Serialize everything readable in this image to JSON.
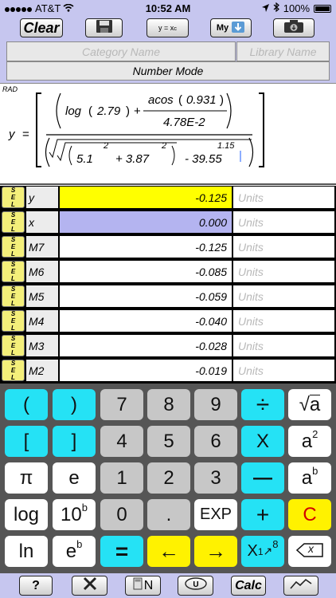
{
  "status": {
    "carrier": "AT&T",
    "time": "10:52 AM",
    "battery": "100%",
    "battery_level": 1.0
  },
  "toolbar": {
    "clear": "Clear",
    "yx": "y = x",
    "yx_sub": "c",
    "my": "My"
  },
  "header": {
    "category_placeholder": "Category Name",
    "library_placeholder": "Library Name",
    "mode": "Number Mode"
  },
  "equation": {
    "angle_mode": "RAD",
    "lhs": "y",
    "eq": "=",
    "log": "log",
    "log_arg": "2.79",
    "plus": "+",
    "acos": "acos",
    "acos_arg": "0.931",
    "divisor": "4.78E-2",
    "base1": "5.1",
    "exp1": "2",
    "plus2": "+ 3.87",
    "exp2": "2",
    "minus": "- 39.55",
    "exp3": "1.15",
    "lp": "(",
    "rp": ")"
  },
  "variables": [
    {
      "name": "y",
      "value": "-0.125",
      "units": "Units",
      "color": "#ffff00"
    },
    {
      "name": "x",
      "value": "0.000",
      "units": "Units",
      "color": "#b4b4f0"
    },
    {
      "name": "M7",
      "value": "-0.125",
      "units": "Units",
      "color": "#ffffff"
    },
    {
      "name": "M6",
      "value": "-0.085",
      "units": "Units",
      "color": "#ffffff"
    },
    {
      "name": "M5",
      "value": "-0.059",
      "units": "Units",
      "color": "#ffffff"
    },
    {
      "name": "M4",
      "value": "-0.040",
      "units": "Units",
      "color": "#ffffff"
    },
    {
      "name": "M3",
      "value": "-0.028",
      "units": "Units",
      "color": "#ffffff"
    },
    {
      "name": "M2",
      "value": "-0.019",
      "units": "Units",
      "color": "#ffffff"
    }
  ],
  "sel_label": "SEL",
  "keys": {
    "lparen": "(",
    "rparen": ")",
    "seven": "7",
    "eight": "8",
    "nine": "9",
    "divide": "÷",
    "sqrt": "a",
    "lbracket": "[",
    "rbracket": "]",
    "four": "4",
    "five": "5",
    "six": "6",
    "multiply": "X",
    "square": "a",
    "square_exp": "2",
    "pi": "π",
    "e": "e",
    "one": "1",
    "two": "2",
    "three": "3",
    "minus": "—",
    "power": "a",
    "power_exp": "b",
    "log": "log",
    "tenpow": "10",
    "tenpow_exp": "b",
    "zero": "0",
    "dot": ".",
    "exp": "EXP",
    "plus": "+",
    "clear": "C",
    "ln": "ln",
    "epow": "e",
    "epow_exp": "b",
    "equals": "=",
    "left": "←",
    "right": "→",
    "store": "X",
    "store_sub": "1",
    "store_exp": "8",
    "backspace": "x"
  },
  "bottom": {
    "help": "?",
    "units": "N",
    "calc": "Calc"
  }
}
